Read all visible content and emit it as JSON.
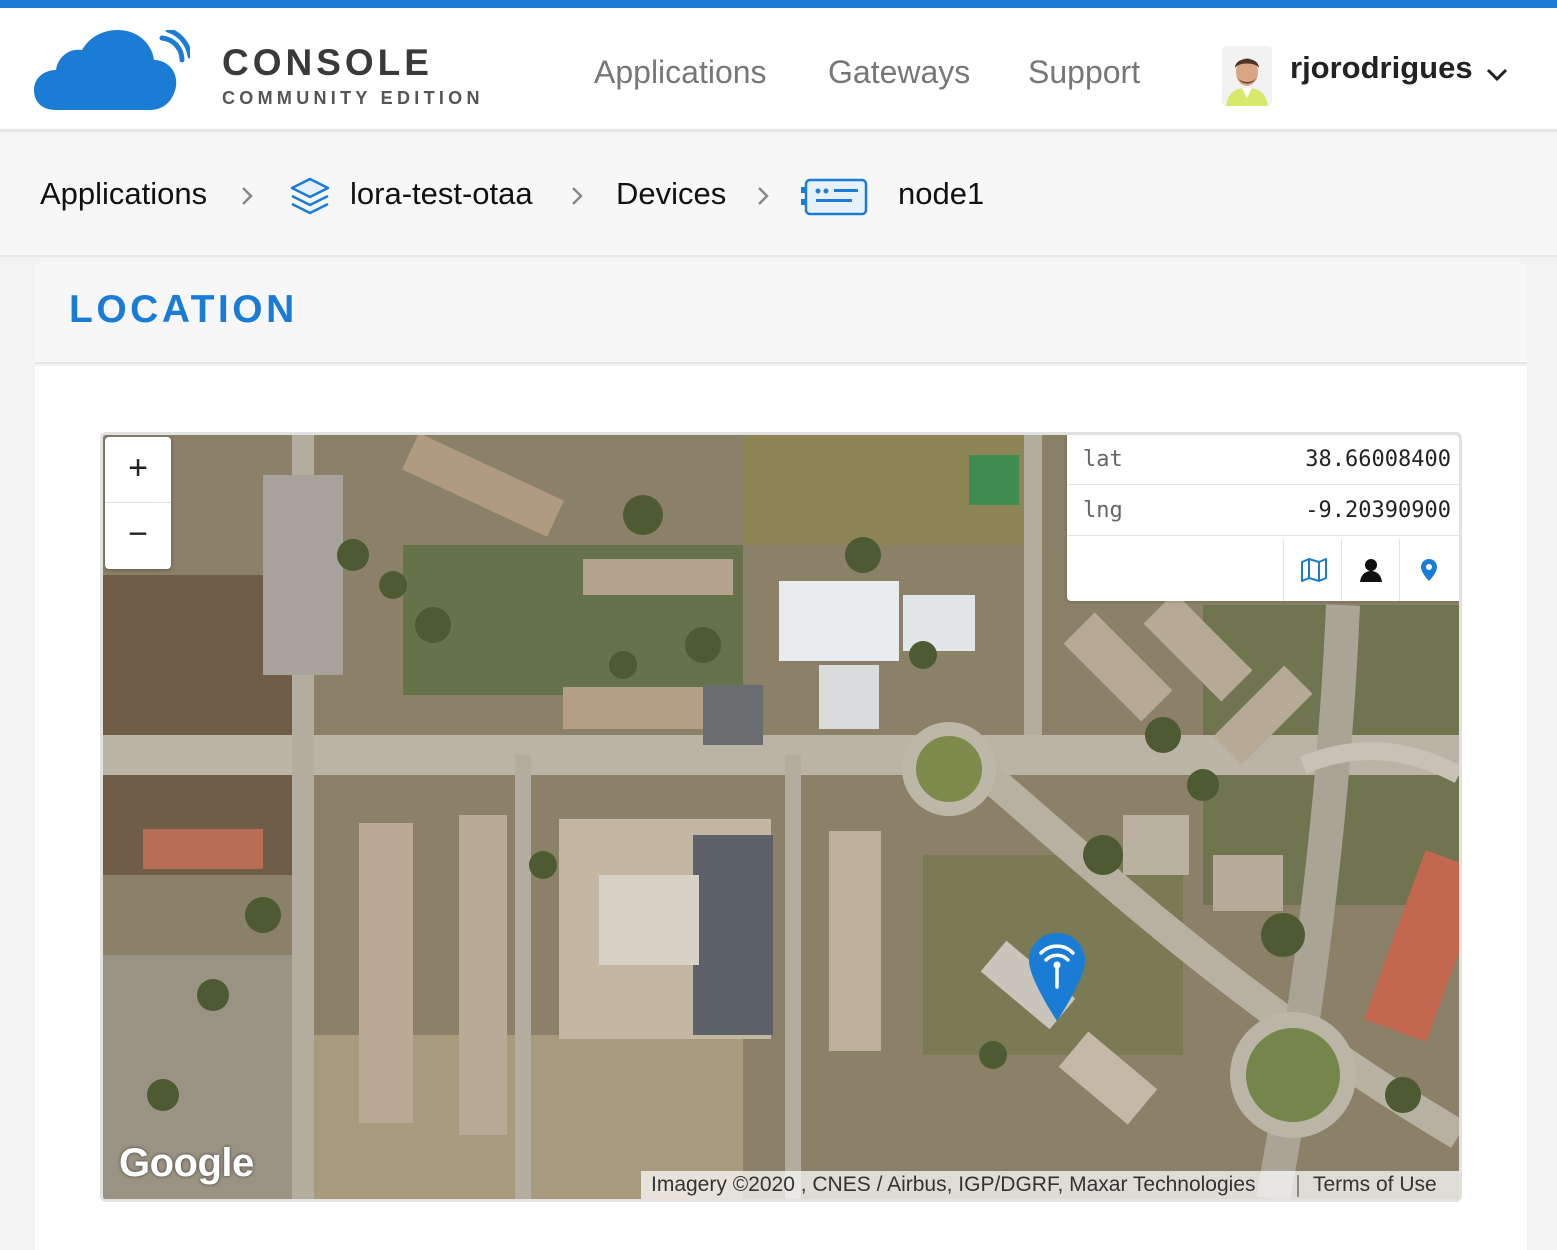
{
  "header": {
    "brand_title": "CONSOLE",
    "brand_subtitle": "COMMUNITY EDITION",
    "nav": [
      "Applications",
      "Gateways",
      "Support"
    ],
    "username": "rjorodrigues",
    "accent_color": "#1b7cd6"
  },
  "breadcrumb": {
    "items": [
      "Applications",
      "lora-test-otaa",
      "Devices",
      "node1"
    ],
    "icons": [
      "layers-icon",
      "device-icon"
    ]
  },
  "section": {
    "title": "LOCATION"
  },
  "map": {
    "zoom_in": "+",
    "zoom_out": "−",
    "lat_label": "lat",
    "lat_value": "38.66008400",
    "lng_label": "lng",
    "lng_value": "-9.20390900",
    "mode_icons": [
      "map-icon",
      "person-icon",
      "pin-icon"
    ],
    "google_logo": "Google",
    "attribution": "Imagery ©2020 , CNES / Airbus, IGP/DGRF, Maxar Technologies",
    "terms": "Terms of Use",
    "marker_icon": "gateway-antenna-icon"
  }
}
